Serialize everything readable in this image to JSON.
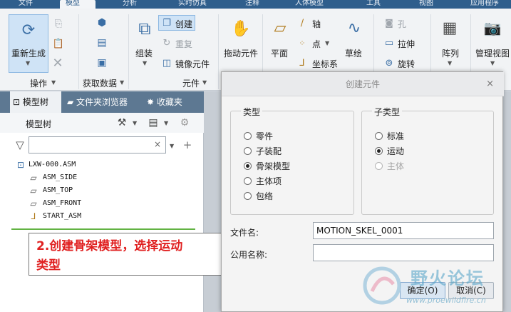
{
  "app_tabs": [
    "文件",
    "模型",
    "分析",
    "实时仿真",
    "注释",
    "人体模型",
    "工具",
    "视图",
    "应用程序"
  ],
  "ribbon": {
    "operations": {
      "regenerate": "重新生成",
      "group": "操作"
    },
    "get_data": {
      "group": "获取数据"
    },
    "component": {
      "assemble": "组装",
      "create": "创建",
      "repeat": "重复",
      "mirror": "镜像元件",
      "group": "元件"
    },
    "drag": "拖动元件",
    "datum": {
      "plane": "平面",
      "axis": "轴",
      "point": "点",
      "csys": "坐标系",
      "sketch": "草绘"
    },
    "modify": {
      "hole": "孔",
      "extrude": "拉伸",
      "revolve": "旋转"
    },
    "pattern": "阵列",
    "manage_views": "管理视图"
  },
  "left_panel": {
    "tabs": [
      "模型树",
      "文件夹浏览器",
      "收藏夹"
    ],
    "tree_title": "模型树",
    "filter_value": "",
    "nodes": [
      "LXW-000.ASM",
      "ASM_SIDE",
      "ASM_TOP",
      "ASM_FRONT",
      "START_ASM"
    ]
  },
  "note": {
    "line1": "2.创建骨架模型，选择运动",
    "line2": "类型"
  },
  "dialog": {
    "title": "创建元件",
    "close": "×",
    "type_legend": "类型",
    "type_options": [
      "零件",
      "子装配",
      "骨架模型",
      "主体项",
      "包络"
    ],
    "type_selected": "骨架模型",
    "subtype_legend": "子类型",
    "subtype_options": [
      "标准",
      "运动",
      "主体"
    ],
    "subtype_selected": "运动",
    "subtype_disabled": "主体",
    "filename_label": "文件名:",
    "filename_value": "MOTION_SKEL_0001",
    "common_name_label": "公用名称:",
    "common_name_value": "",
    "ok": "确定(O)",
    "cancel": "取消(C)"
  },
  "watermark": {
    "title": "野火论坛",
    "url": "www.proewildfire.cn"
  },
  "colors": {
    "ribbon_blue": "#2f5e8c",
    "panel_tab_bar": "#5d7892",
    "note_red": "#e02020",
    "tree_green_line": "#62b342"
  }
}
